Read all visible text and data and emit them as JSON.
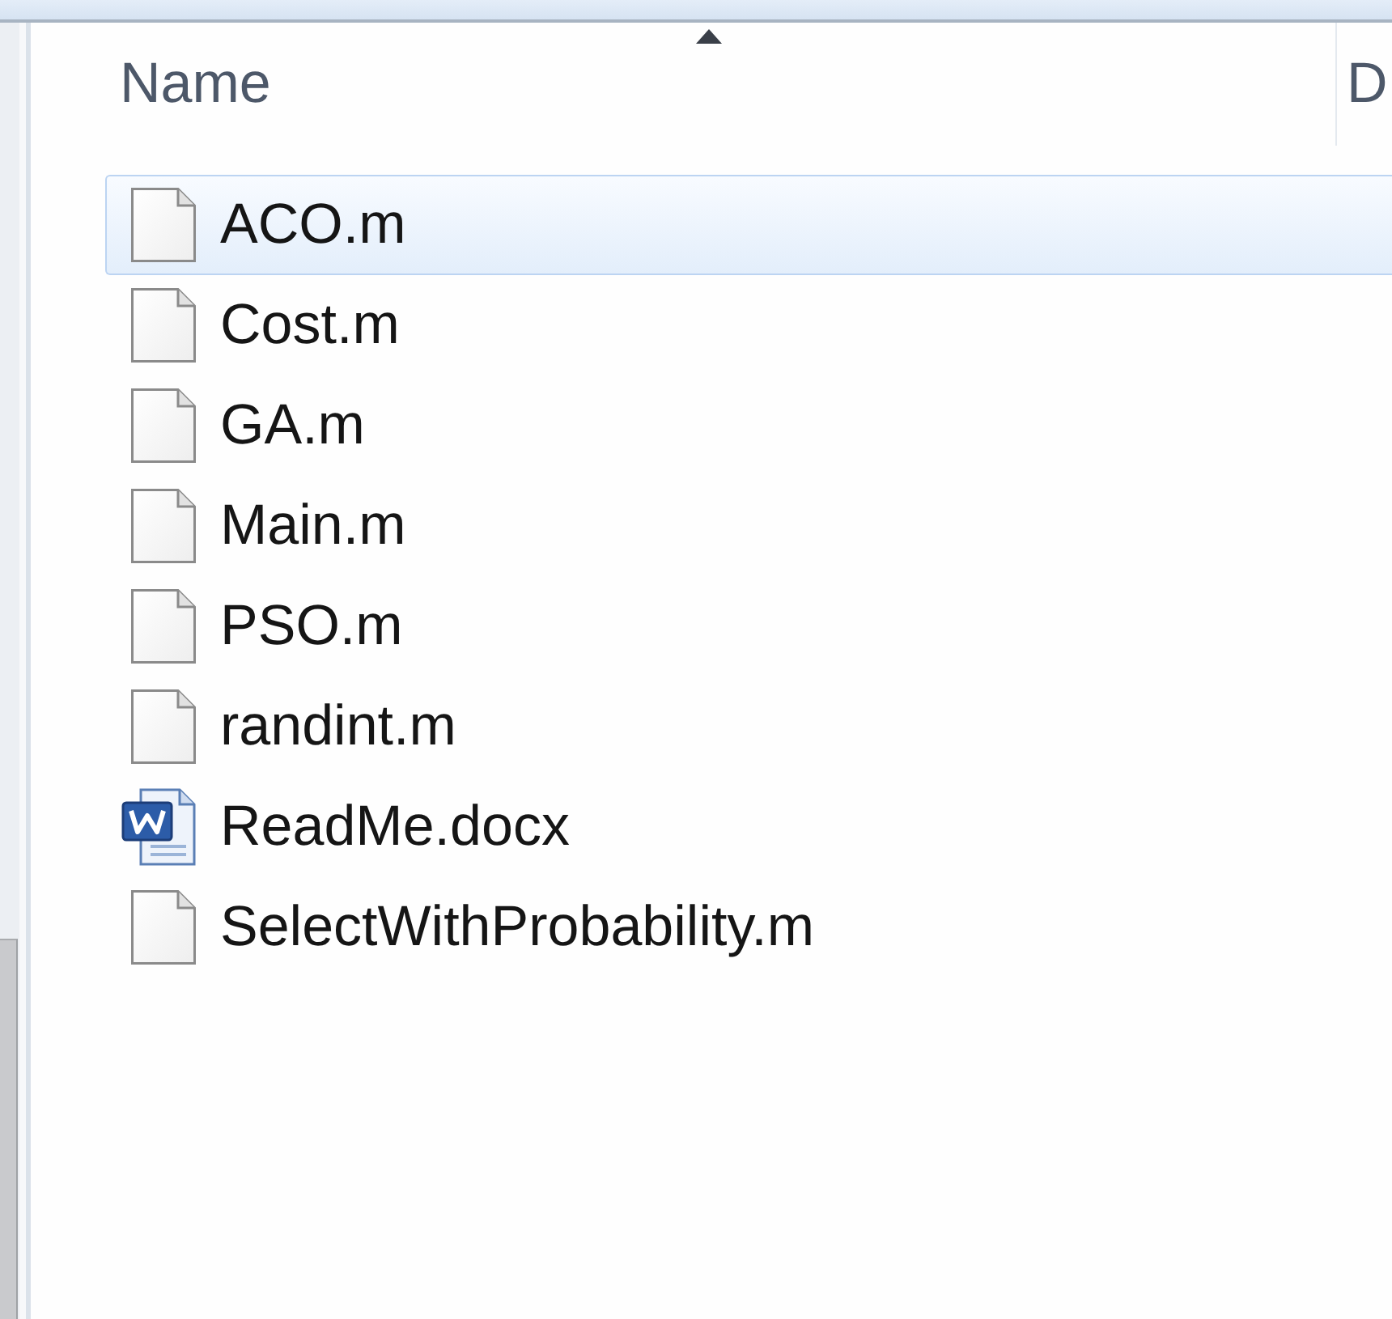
{
  "column_headers": [
    {
      "label": "Name",
      "sorted": true
    },
    {
      "label": "D",
      "sorted": false
    }
  ],
  "files": [
    {
      "name": "ACO.m",
      "kind": "file",
      "selected": true
    },
    {
      "name": "Cost.m",
      "kind": "file",
      "selected": false
    },
    {
      "name": "GA.m",
      "kind": "file",
      "selected": false
    },
    {
      "name": "Main.m",
      "kind": "file",
      "selected": false
    },
    {
      "name": "PSO.m",
      "kind": "file",
      "selected": false
    },
    {
      "name": "randint.m",
      "kind": "file",
      "selected": false
    },
    {
      "name": "ReadMe.docx",
      "kind": "document",
      "selected": false
    },
    {
      "name": "SelectWithProbability.m",
      "kind": "file",
      "selected": false
    }
  ]
}
